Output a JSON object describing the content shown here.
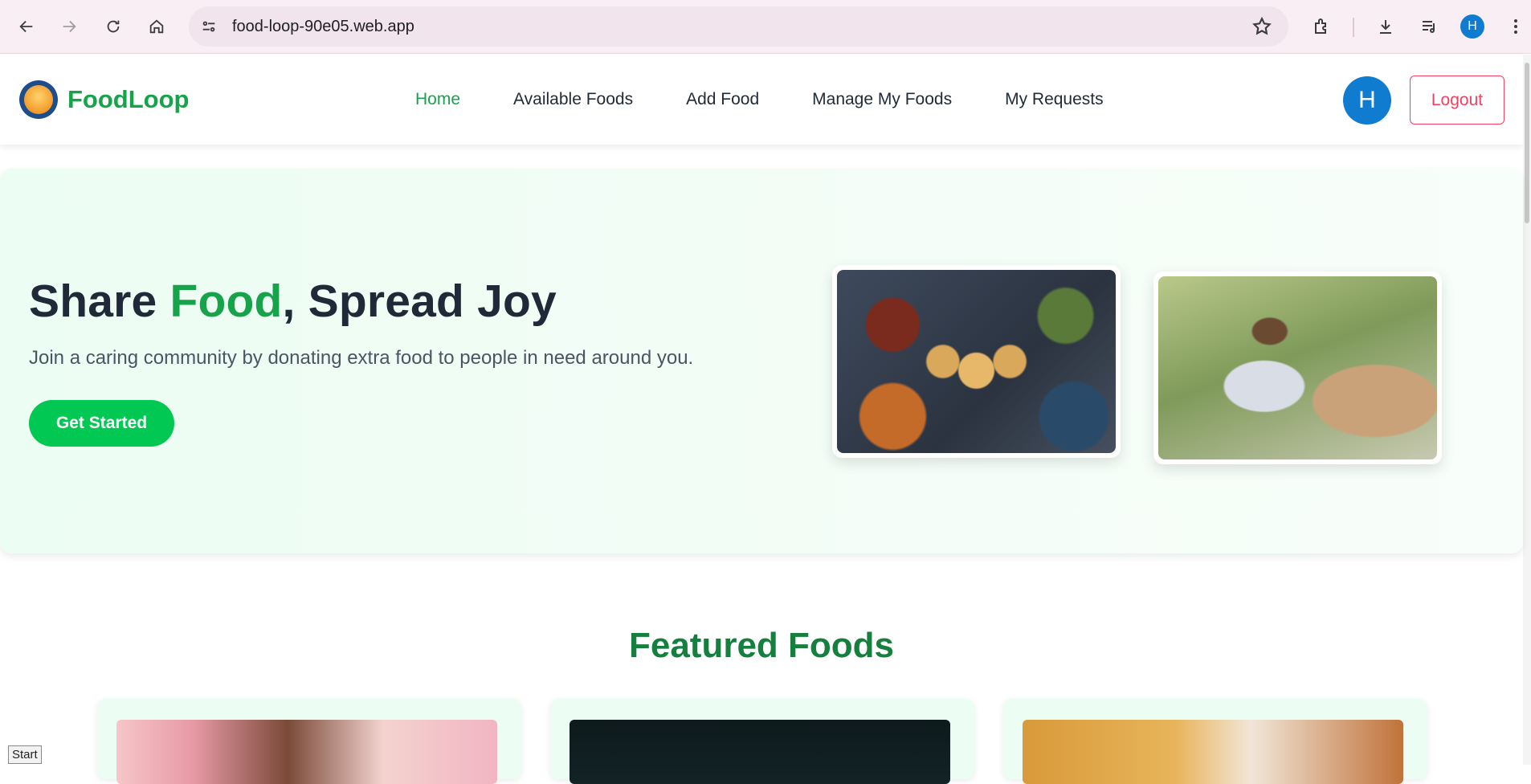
{
  "browser": {
    "url": "food-loop-90e05.web.app",
    "profile_initial": "H"
  },
  "site": {
    "brand": "FoodLoop",
    "nav": [
      {
        "label": "Home",
        "active": true
      },
      {
        "label": "Available Foods",
        "active": false
      },
      {
        "label": "Add Food",
        "active": false
      },
      {
        "label": "Manage My Foods",
        "active": false
      },
      {
        "label": "My Requests",
        "active": false
      }
    ],
    "avatar_initial": "H",
    "logout_label": "Logout"
  },
  "hero": {
    "title_part1": "Share ",
    "title_accent": "Food",
    "title_part2": ", Spread Joy",
    "subtitle": "Join a caring community by donating extra food to people in need around you.",
    "cta_label": "Get Started"
  },
  "featured": {
    "title": "Featured Foods"
  },
  "overlay": {
    "start_label": "Start"
  },
  "colors": {
    "brand_green": "#16a34a",
    "cta_green": "#00c853",
    "logout_red": "#f43f5e",
    "avatar_blue": "#0f7ccf"
  }
}
